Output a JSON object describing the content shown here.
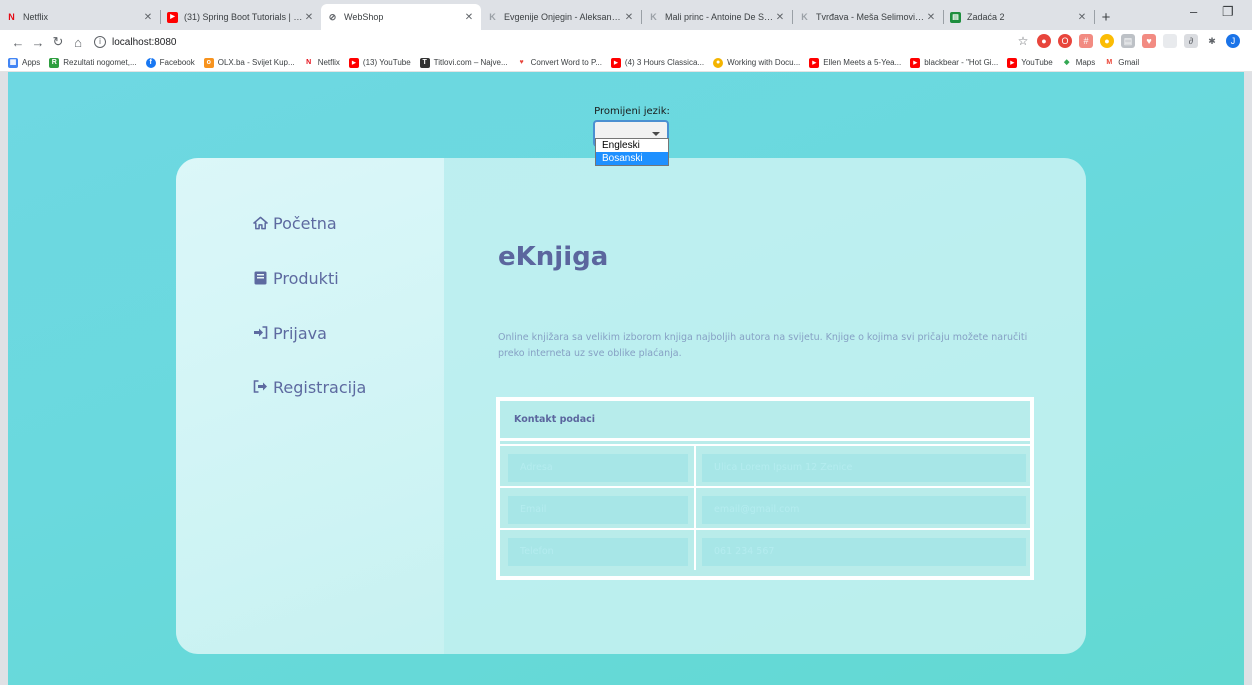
{
  "browser": {
    "tabs": [
      {
        "title": "Netflix",
        "icon": "netflix-icon",
        "active": false
      },
      {
        "title": "(31) Spring Boot Tutorials | Full C",
        "icon": "youtube-icon",
        "active": false
      },
      {
        "title": "WebShop",
        "icon": "globe-icon",
        "active": true
      },
      {
        "title": "Evgenije Onjegin - Aleksandar P",
        "icon": "book-icon",
        "active": false
      },
      {
        "title": "Mali princ - Antoine De Saint Ex",
        "icon": "book-icon",
        "active": false
      },
      {
        "title": "Tvrđava - Meša Selimović | Knjig",
        "icon": "book-icon",
        "active": false
      },
      {
        "title": "Zadaća 2",
        "icon": "classroom-icon",
        "active": false
      }
    ],
    "url": "localhost:8080",
    "bookmarks": [
      {
        "label": "Apps",
        "color": "#4285f4",
        "glyph": "▦"
      },
      {
        "label": "Rezultati nogomet,...",
        "color": "#2e9e3f",
        "glyph": "R"
      },
      {
        "label": "Facebook",
        "color": "#1877f2",
        "glyph": "f"
      },
      {
        "label": "OLX.ba - Svijet Kup...",
        "color": "#f7931e",
        "glyph": "o"
      },
      {
        "label": "Netflix",
        "color": "#e50914",
        "glyph": "N"
      },
      {
        "label": "(13) YouTube",
        "color": "#ff0000",
        "glyph": "▶"
      },
      {
        "label": "Titlovi.com – Najve...",
        "color": "#333333",
        "glyph": "T"
      },
      {
        "label": "Convert Word to P...",
        "color": "#e8453c",
        "glyph": "♥"
      },
      {
        "label": "(4) 3 Hours Classica...",
        "color": "#ff0000",
        "glyph": "▶"
      },
      {
        "label": "Working with Docu...",
        "color": "#f4b400",
        "glyph": "●"
      },
      {
        "label": "Ellen Meets a 5-Yea...",
        "color": "#ff0000",
        "glyph": "▶"
      },
      {
        "label": "blackbear - \"Hot Gi...",
        "color": "#ff0000",
        "glyph": "▶"
      },
      {
        "label": "YouTube",
        "color": "#ff0000",
        "glyph": "▶"
      },
      {
        "label": "Maps",
        "color": "#34a853",
        "glyph": "◆"
      },
      {
        "label": "Gmail",
        "color": "#ea4335",
        "glyph": "M"
      }
    ],
    "apps_label": "Apps"
  },
  "language": {
    "label": "Promijeni jezik:",
    "selected": "",
    "options": [
      "Engleski",
      "Bosanski"
    ],
    "highlighted": "Bosanski"
  },
  "nav": {
    "pocetna": "Početna",
    "produkti": "Produkti",
    "prijava": "Prijava",
    "registracija": "Registracija"
  },
  "main": {
    "title": "eKnjiga",
    "description": "Online knjižara sa velikim izborom knjiga najboljih autora na svijetu. Knjige o kojima svi pričaju možete naručiti preko interneta uz sve oblike plaćanja."
  },
  "contact": {
    "header": "Kontakt podaci",
    "rows": [
      {
        "key": "Adresa",
        "value": "Ulica Lorem Ipsum 12 Zenice"
      },
      {
        "key": "Email",
        "value": "email@gmail.com"
      },
      {
        "key": "Telefon",
        "value": "061 234 567"
      }
    ]
  },
  "colors": {
    "accent": "#5b669e",
    "page_bg": "#6ad9de"
  }
}
